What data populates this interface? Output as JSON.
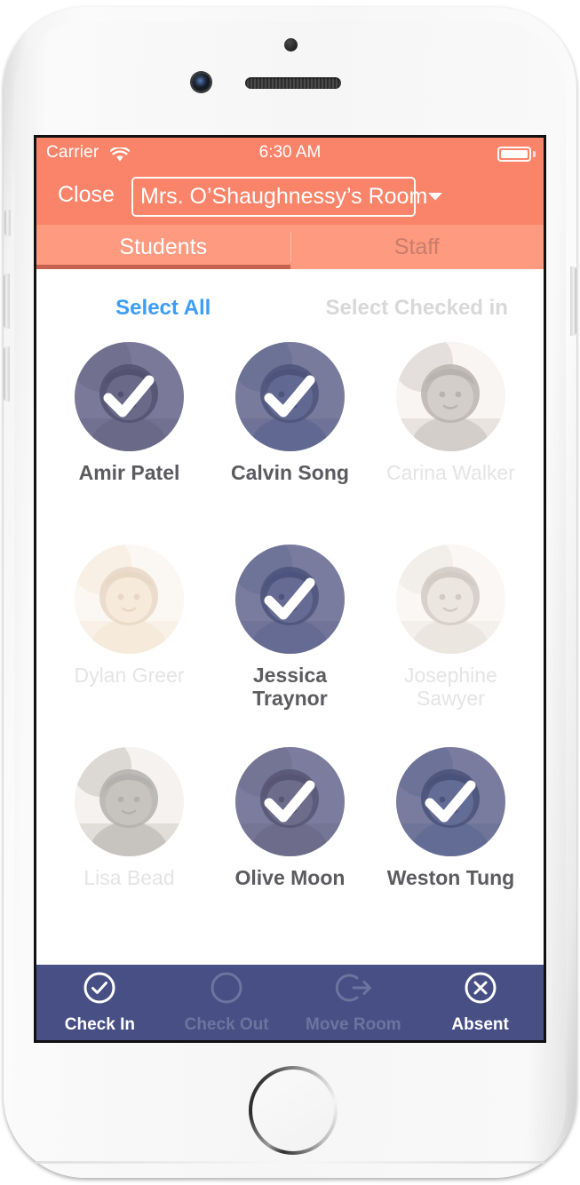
{
  "status_bar": {
    "carrier": "Carrier",
    "wifi_icon": "wifi-icon",
    "time": "6:30 AM",
    "battery_icon": "battery-full-icon"
  },
  "nav_bar": {
    "close_label": "Close",
    "room_selector_value": "Mrs. O’Shaughnessy’s Room",
    "caret_icon": "chevron-down-icon"
  },
  "tabs": [
    {
      "label": "Students",
      "active": true
    },
    {
      "label": "Staff",
      "active": false
    }
  ],
  "select_actions": {
    "select_all": "Select All",
    "select_checked_in": "Select Checked in"
  },
  "students": [
    {
      "name": "Amir Patel",
      "selected": true
    },
    {
      "name": "Calvin Song",
      "selected": true
    },
    {
      "name": "Carina Walker",
      "selected": false
    },
    {
      "name": "Dylan Greer",
      "selected": false
    },
    {
      "name": "Jessica Traynor",
      "selected": true
    },
    {
      "name": "Josephine Sawyer",
      "selected": false
    },
    {
      "name": "Lisa Bead",
      "selected": false
    },
    {
      "name": "Olive Moon",
      "selected": true
    },
    {
      "name": "Weston Tung",
      "selected": true
    }
  ],
  "toolbar": [
    {
      "label": "Check In",
      "icon": "check-circle-icon",
      "enabled": true
    },
    {
      "label": "Check Out",
      "icon": "circle-icon",
      "enabled": false
    },
    {
      "label": "Move Room",
      "icon": "exit-arrow-icon",
      "enabled": false
    },
    {
      "label": "Absent",
      "icon": "x-circle-icon",
      "enabled": true
    }
  ],
  "colors": {
    "header_orange": "#FA8469",
    "tabbar_orange": "#FE9A80",
    "tab_underline": "#C4644F",
    "toolbar_navy": "#474F84",
    "select_all_blue": "#3C9DF7",
    "disabled_gray": "#D8D8D8",
    "selected_tint": "rgba(72,79,130,0.70)"
  }
}
